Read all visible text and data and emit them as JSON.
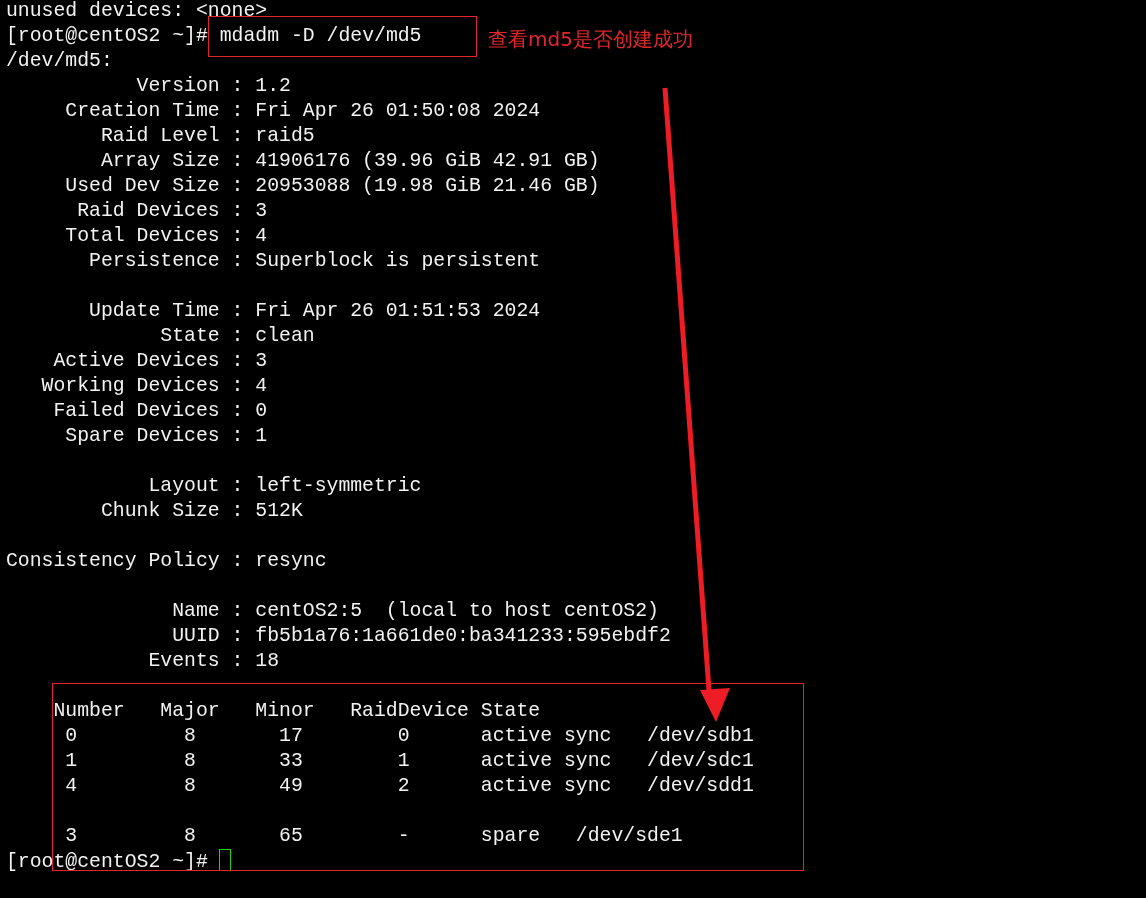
{
  "terminal": {
    "first_line": "unused devices: <none>",
    "prompt": "[root@centOS2 ~]#",
    "command": "mdadm -D /dev/md5",
    "device": "/dev/md5:",
    "field_groups": [
      [
        "           Version : 1.2",
        "     Creation Time : Fri Apr 26 01:50:08 2024",
        "        Raid Level : raid5",
        "        Array Size : 41906176 (39.96 GiB 42.91 GB)",
        "     Used Dev Size : 20953088 (19.98 GiB 21.46 GB)",
        "      Raid Devices : 3",
        "     Total Devices : 4",
        "       Persistence : Superblock is persistent"
      ],
      [
        "       Update Time : Fri Apr 26 01:51:53 2024",
        "             State : clean",
        "    Active Devices : 3",
        "   Working Devices : 4",
        "    Failed Devices : 0",
        "     Spare Devices : 1"
      ],
      [
        "            Layout : left-symmetric",
        "        Chunk Size : 512K"
      ],
      [
        "Consistency Policy : resync"
      ],
      [
        "              Name : centOS2:5  (local to host centOS2)",
        "              UUID : fb5b1a76:1a661de0:ba341233:595ebdf2",
        "            Events : 18"
      ]
    ],
    "table_header": "    Number   Major   Minor   RaidDevice State",
    "table_rows": [
      "     0         8       17        0      active sync   /dev/sdb1",
      "     1         8       33        1      active sync   /dev/sdc1",
      "     4         8       49        2      active sync   /dev/sdd1"
    ],
    "spare_rows": [
      "     3         8       65        -      spare   /dev/sde1"
    ],
    "final_prompt": "[root@centOS2 ~]#"
  },
  "annotation": {
    "note": "查看md5是否创建成功"
  }
}
